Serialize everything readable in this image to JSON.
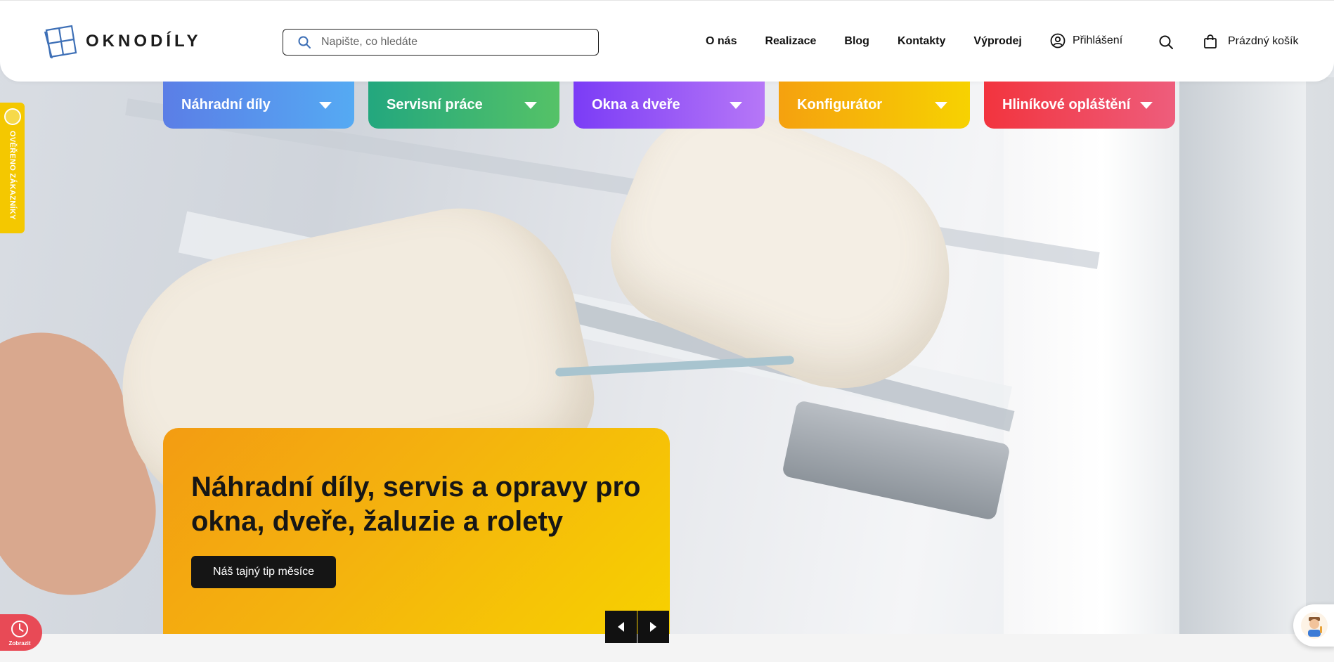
{
  "header": {
    "logo_text": "OKNODÍLY",
    "search_placeholder": "Napište, co hledáte",
    "nav": [
      "O nás",
      "Realizace",
      "Blog",
      "Kontakty",
      "Výprodej"
    ],
    "login_label": "Přihlášení",
    "cart_label": "Prázdný košík"
  },
  "categories": [
    {
      "label": "Náhradní díly",
      "color_from": "#5b7ee6",
      "color_to": "#55aaf3"
    },
    {
      "label": "Servisní práce",
      "color_from": "#23a77e",
      "color_to": "#55c267"
    },
    {
      "label": "Okna a dveře",
      "color_from": "#7b3cf6",
      "color_to": "#b677f7"
    },
    {
      "label": "Konfigurátor",
      "color_from": "#f5a10f",
      "color_to": "#f7d201"
    },
    {
      "label": "Hliníkové opláštění",
      "color_from": "#f2343e",
      "color_to": "#ee5d7c"
    }
  ],
  "side_badge": {
    "label": "OVĚŘENO ZÁKAZNÍKY"
  },
  "hero": {
    "title": "Náhradní díly, servis a opravy pro okna, dveře, žaluzie a rolety",
    "cta_label": "Náš tajný tip měsíce"
  },
  "widgets": {
    "show_label": "Zobrazit"
  },
  "icons": {
    "logo": "window-logo-icon",
    "search": "search-icon",
    "login": "user-circle-icon",
    "cart": "shopping-bag-icon",
    "dropdown": "triangle-down-icon",
    "prev": "arrow-left-icon",
    "next": "arrow-right-icon",
    "clock": "clock-icon",
    "chat": "chat-avatar-icon"
  }
}
